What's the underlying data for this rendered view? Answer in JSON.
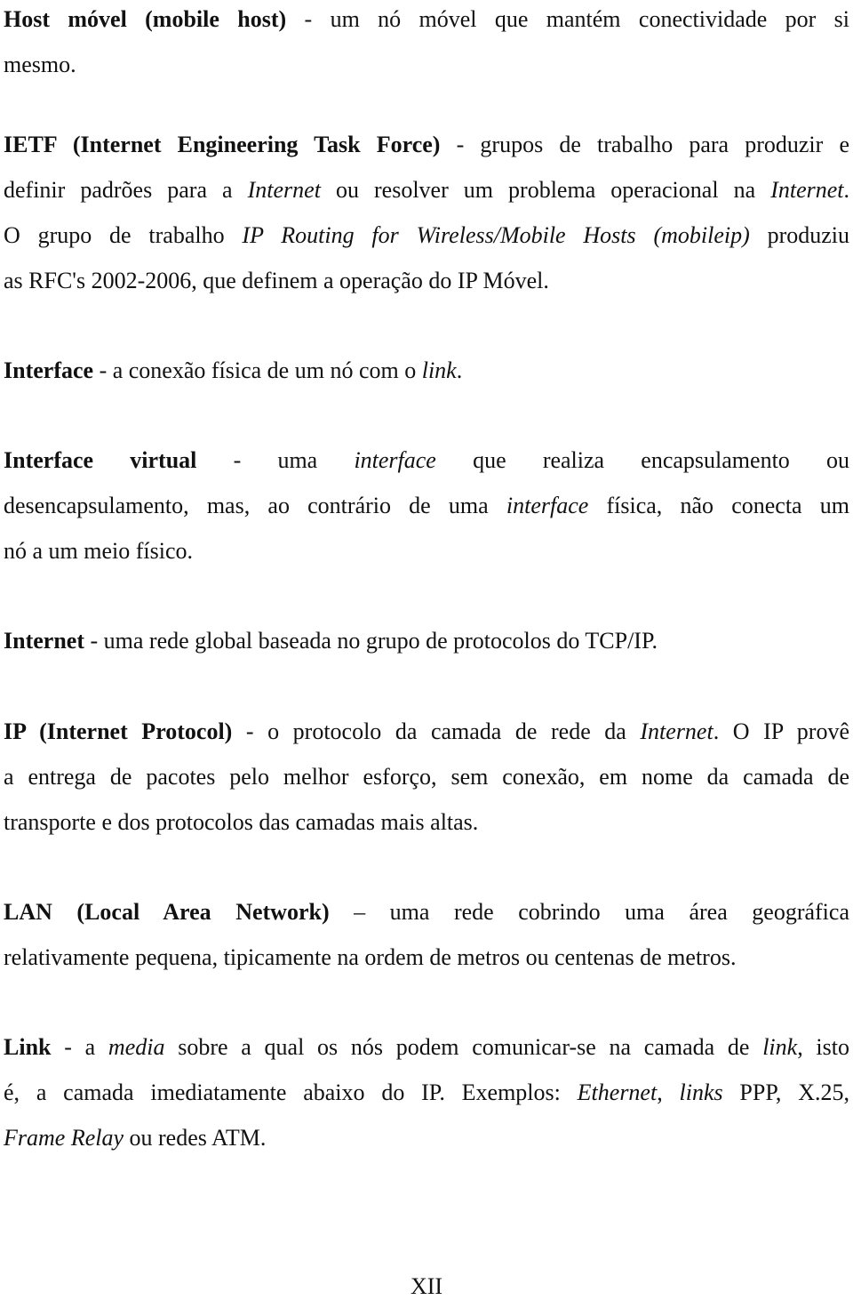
{
  "entries": [
    {
      "term": "Host móvel (mobile host)",
      "lines": [
        {
          "segments": [
            {
              "t": "Host móvel (mobile host)",
              "s": "b"
            },
            {
              "t": " - um nó móvel que mantém conectividade por si",
              "s": "n"
            }
          ],
          "justify": true
        },
        {
          "segments": [
            {
              "t": "mesmo.",
              "s": "n"
            }
          ],
          "justify": false
        }
      ]
    },
    {
      "term": "IETF (Internet Engineering Task Force)",
      "lines": [
        {
          "segments": [
            {
              "t": "IETF (Internet Engineering Task Force)",
              "s": "b"
            },
            {
              "t": " - grupos de trabalho para produzir e",
              "s": "n"
            }
          ],
          "justify": true
        },
        {
          "segments": [
            {
              "t": "definir padrões para a ",
              "s": "n"
            },
            {
              "t": "Internet",
              "s": "i"
            },
            {
              "t": " ou resolver um problema operacional na ",
              "s": "n"
            },
            {
              "t": "Internet",
              "s": "i"
            },
            {
              "t": ".",
              "s": "n"
            }
          ],
          "justify": true
        },
        {
          "segments": [
            {
              "t": "O grupo de trabalho ",
              "s": "n"
            },
            {
              "t": "IP Routing for Wireless/Mobile Hosts (mobileip)",
              "s": "i"
            },
            {
              "t": " produziu",
              "s": "n"
            }
          ],
          "justify": true
        },
        {
          "segments": [
            {
              "t": "as RFC's 2002-2006, que definem a operação do IP Móvel.",
              "s": "n"
            }
          ],
          "justify": false
        }
      ]
    },
    {
      "term": "Interface",
      "lines": [
        {
          "segments": [
            {
              "t": "Interface",
              "s": "b"
            },
            {
              "t": " - a conexão física de um nó com o ",
              "s": "n"
            },
            {
              "t": "link",
              "s": "i"
            },
            {
              "t": ".",
              "s": "n"
            }
          ],
          "justify": false
        }
      ]
    },
    {
      "term": "Interface virtual",
      "lines": [
        {
          "segments": [
            {
              "t": "Interface virtual",
              "s": "b"
            },
            {
              "t": " - uma ",
              "s": "n"
            },
            {
              "t": "interface",
              "s": "i"
            },
            {
              "t": " que realiza encapsulamento ou",
              "s": "n"
            }
          ],
          "justify": true
        },
        {
          "segments": [
            {
              "t": "desencapsulamento, mas, ao contrário de uma ",
              "s": "n"
            },
            {
              "t": "interface",
              "s": "i"
            },
            {
              "t": " física, não conecta um",
              "s": "n"
            }
          ],
          "justify": true
        },
        {
          "segments": [
            {
              "t": "nó a um meio físico.",
              "s": "n"
            }
          ],
          "justify": false
        }
      ]
    },
    {
      "term": "Internet",
      "lines": [
        {
          "segments": [
            {
              "t": "Internet",
              "s": "b"
            },
            {
              "t": " - uma rede global baseada no grupo de protocolos do TCP/IP.",
              "s": "n"
            }
          ],
          "justify": false
        }
      ]
    },
    {
      "term": "IP (Internet Protocol)",
      "lines": [
        {
          "segments": [
            {
              "t": "IP (Internet Protocol)",
              "s": "b"
            },
            {
              "t": " - o protocolo da camada de rede da ",
              "s": "n"
            },
            {
              "t": "Internet",
              "s": "i"
            },
            {
              "t": ". O IP provê",
              "s": "n"
            }
          ],
          "justify": true
        },
        {
          "segments": [
            {
              "t": "a entrega de pacotes pelo melhor esforço, sem conexão, em nome da camada de",
              "s": "n"
            }
          ],
          "justify": true
        },
        {
          "segments": [
            {
              "t": "transporte e dos protocolos das camadas mais altas.",
              "s": "n"
            }
          ],
          "justify": false
        }
      ]
    },
    {
      "term": "LAN (Local Area Network)",
      "lines": [
        {
          "segments": [
            {
              "t": "LAN (Local Area Network)",
              "s": "b"
            },
            {
              "t": " – uma rede cobrindo uma área geográfica",
              "s": "n"
            }
          ],
          "justify": true
        },
        {
          "segments": [
            {
              "t": "relativamente pequena, tipicamente na ordem de metros ou centenas de metros.",
              "s": "n"
            }
          ],
          "justify": false
        }
      ]
    },
    {
      "term": "Link",
      "lines": [
        {
          "segments": [
            {
              "t": "Link",
              "s": "b"
            },
            {
              "t": " - a ",
              "s": "n"
            },
            {
              "t": "media",
              "s": "i"
            },
            {
              "t": " sobre a qual os nós podem comunicar-se na camada de ",
              "s": "n"
            },
            {
              "t": "link",
              "s": "i"
            },
            {
              "t": ", isto",
              "s": "n"
            }
          ],
          "justify": true
        },
        {
          "segments": [
            {
              "t": "é, a camada imediatamente abaixo do IP. Exemplos: ",
              "s": "n"
            },
            {
              "t": "Ethernet",
              "s": "i"
            },
            {
              "t": ", ",
              "s": "n"
            },
            {
              "t": "links",
              "s": "i"
            },
            {
              "t": " PPP, X.25,",
              "s": "n"
            }
          ],
          "justify": true
        },
        {
          "segments": [
            {
              "t": "Frame Relay",
              "s": "i"
            },
            {
              "t": " ou redes ATM.",
              "s": "n"
            }
          ],
          "justify": false
        }
      ]
    }
  ],
  "page_number": "XII"
}
